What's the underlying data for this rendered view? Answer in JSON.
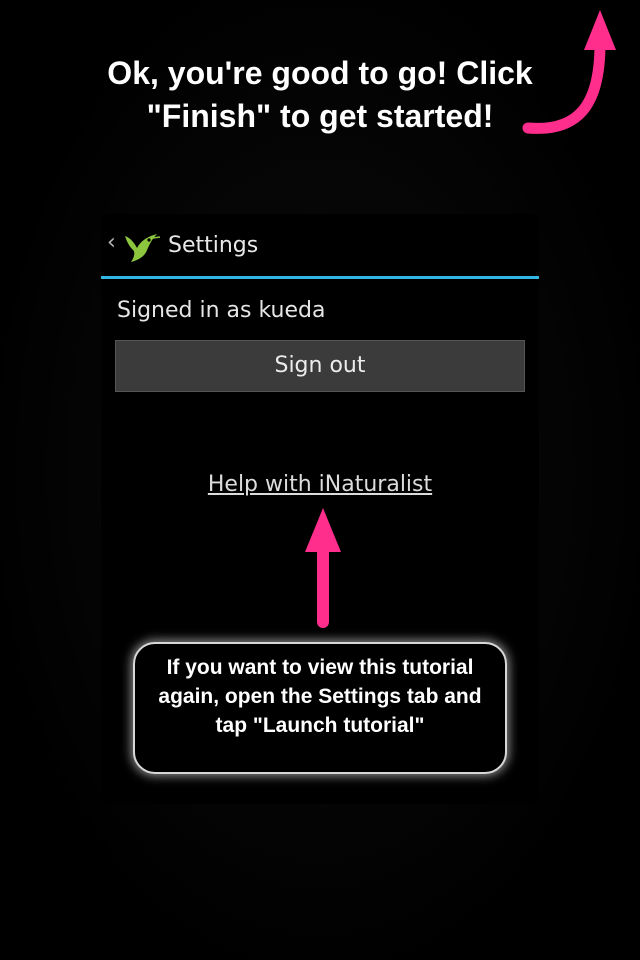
{
  "tutorial": {
    "headline": "Ok, you're good to go! Click \"Finish\" to get started!",
    "callout": "If you want to view this tutorial again, open the Settings tab and tap \"Launch tutorial\""
  },
  "screen": {
    "action_bar": {
      "back_icon": "chevron-left-icon",
      "app_icon": "hummingbird-logo-icon",
      "title": "Settings"
    },
    "signed_in_text": "Signed in as kueda",
    "sign_out_label": "Sign out",
    "help_link_text": "Help with iNaturalist"
  },
  "colors": {
    "accent_underline": "#33b5e5",
    "arrow_pink": "#ff2d8c",
    "logo_green": "#8cc63f"
  }
}
